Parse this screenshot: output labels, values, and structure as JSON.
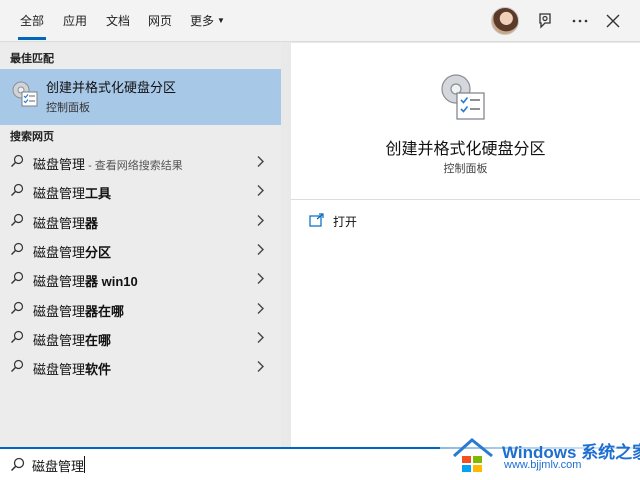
{
  "tabs": [
    {
      "label": "全部",
      "active": true
    },
    {
      "label": "应用"
    },
    {
      "label": "文档"
    },
    {
      "label": "网页"
    },
    {
      "label": "更多"
    }
  ],
  "topbar_icons": [
    "avatar",
    "feedback-icon",
    "more-icon",
    "close-icon"
  ],
  "best_match": {
    "header": "最佳匹配",
    "title": "创建并格式化硬盘分区",
    "subtitle": "控制面板",
    "icon": "control-panel-disk-icon"
  },
  "web_search": {
    "header": "搜索网页",
    "results": [
      {
        "prefix": "磁盘管理",
        "bold": "",
        "hint": " - 查看网络搜索结果"
      },
      {
        "prefix": "磁盘管理",
        "bold": "工具",
        "hint": ""
      },
      {
        "prefix": "磁盘管理",
        "bold": "器",
        "hint": ""
      },
      {
        "prefix": "磁盘管理",
        "bold": "分区",
        "hint": ""
      },
      {
        "prefix": "磁盘管理",
        "bold": "器 win10",
        "hint": ""
      },
      {
        "prefix": "磁盘管理",
        "bold": "器在哪",
        "hint": ""
      },
      {
        "prefix": "磁盘管理",
        "bold": "在哪",
        "hint": ""
      },
      {
        "prefix": "磁盘管理",
        "bold": "软件",
        "hint": ""
      }
    ]
  },
  "preview": {
    "title": "创建并格式化硬盘分区",
    "subtitle": "控制面板",
    "open_label": "打开"
  },
  "search": {
    "value": "磁盘管理"
  },
  "watermark": {
    "brand": "Windows",
    "brand_cn": "系统之家",
    "url": "www.bjjmlv.com"
  },
  "colors": {
    "accent": "#0067c0",
    "selected": "#a8c8e8",
    "left_bg": "#ececec",
    "right_bg": "#ffffff"
  }
}
